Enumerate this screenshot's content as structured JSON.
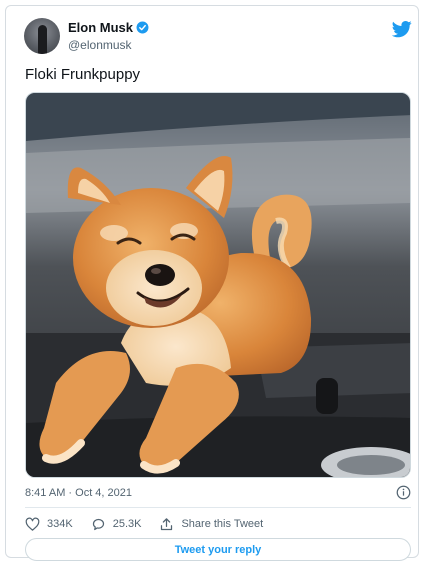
{
  "tweet": {
    "author_name": "Elon Musk",
    "author_handle": "@elonmusk",
    "verified": true,
    "text": "Floki Frunkpuppy",
    "timestamp": "8:41 AM · Oct 4, 2021",
    "image_description": "Shiba Inu puppy resting in car frunk",
    "likes": "334K",
    "replies": "25.3K",
    "share_label": "Share this Tweet",
    "reply_button_label": "Tweet your reply"
  },
  "colors": {
    "brand_blue": "#1d9bf0",
    "text_primary": "#0f1419",
    "text_secondary": "#536471",
    "border": "#cfd9de"
  },
  "icons": {
    "verified": "verified-badge-icon",
    "logo": "twitter-bird-icon",
    "info": "info-icon",
    "like": "heart-icon",
    "reply": "reply-bubble-icon",
    "share": "share-upload-icon"
  }
}
